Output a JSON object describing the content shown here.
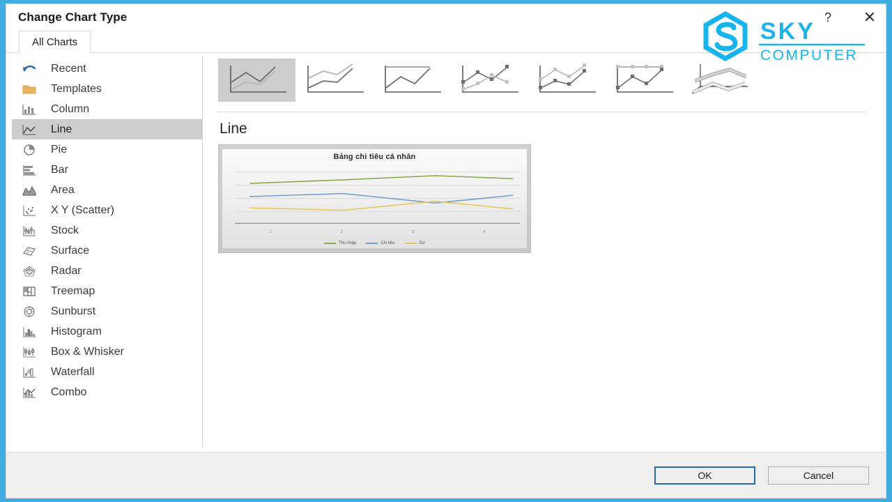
{
  "window": {
    "title": "Change Chart Type",
    "help_label": "?",
    "close_label": "✕",
    "accent_color": "#41ace0"
  },
  "watermark": {
    "brand": "SKY",
    "subbrand": "COMPUTER",
    "color": "#19b4ec"
  },
  "tabs": [
    {
      "label": "All Charts",
      "selected": true
    }
  ],
  "sidebar": {
    "items": [
      {
        "label": "Recent",
        "icon": "recent-icon",
        "selected": false
      },
      {
        "label": "Templates",
        "icon": "folder-icon",
        "selected": false
      },
      {
        "label": "Column",
        "icon": "column-chart-icon",
        "selected": false
      },
      {
        "label": "Line",
        "icon": "line-chart-icon",
        "selected": true
      },
      {
        "label": "Pie",
        "icon": "pie-chart-icon",
        "selected": false
      },
      {
        "label": "Bar",
        "icon": "bar-chart-icon",
        "selected": false
      },
      {
        "label": "Area",
        "icon": "area-chart-icon",
        "selected": false
      },
      {
        "label": "X Y (Scatter)",
        "icon": "scatter-chart-icon",
        "selected": false
      },
      {
        "label": "Stock",
        "icon": "stock-chart-icon",
        "selected": false
      },
      {
        "label": "Surface",
        "icon": "surface-chart-icon",
        "selected": false
      },
      {
        "label": "Radar",
        "icon": "radar-chart-icon",
        "selected": false
      },
      {
        "label": "Treemap",
        "icon": "treemap-icon",
        "selected": false
      },
      {
        "label": "Sunburst",
        "icon": "sunburst-icon",
        "selected": false
      },
      {
        "label": "Histogram",
        "icon": "histogram-icon",
        "selected": false
      },
      {
        "label": "Box & Whisker",
        "icon": "boxwhisker-icon",
        "selected": false
      },
      {
        "label": "Waterfall",
        "icon": "waterfall-icon",
        "selected": false
      },
      {
        "label": "Combo",
        "icon": "combo-chart-icon",
        "selected": false
      }
    ]
  },
  "gallery": {
    "heading": "Line",
    "thumbnails": [
      {
        "name": "line",
        "selected": true
      },
      {
        "name": "stacked-line",
        "selected": false
      },
      {
        "name": "100-percent-stacked-line",
        "selected": false
      },
      {
        "name": "line-with-markers",
        "selected": false
      },
      {
        "name": "stacked-line-with-markers",
        "selected": false
      },
      {
        "name": "100-percent-stacked-line-markers",
        "selected": false
      },
      {
        "name": "3d-line",
        "selected": false
      }
    ]
  },
  "chart_data": {
    "type": "line",
    "title": "Bảng chi tiêu cá nhân",
    "xlabel": "",
    "ylabel": "",
    "categories": [
      "1",
      "2",
      "3",
      "4"
    ],
    "ylim": [
      0,
      100
    ],
    "grid": true,
    "legend_position": "bottom",
    "series": [
      {
        "name": "Thu nhập",
        "color": "#8aa84b",
        "values": [
          72,
          76,
          83,
          80
        ]
      },
      {
        "name": "Chi tiêu",
        "color": "#6f9ccd",
        "values": [
          50,
          55,
          42,
          52
        ]
      },
      {
        "name": "Dư",
        "color": "#e8c55a",
        "values": [
          34,
          31,
          45,
          33
        ]
      }
    ]
  },
  "footer": {
    "ok_label": "OK",
    "cancel_label": "Cancel"
  }
}
